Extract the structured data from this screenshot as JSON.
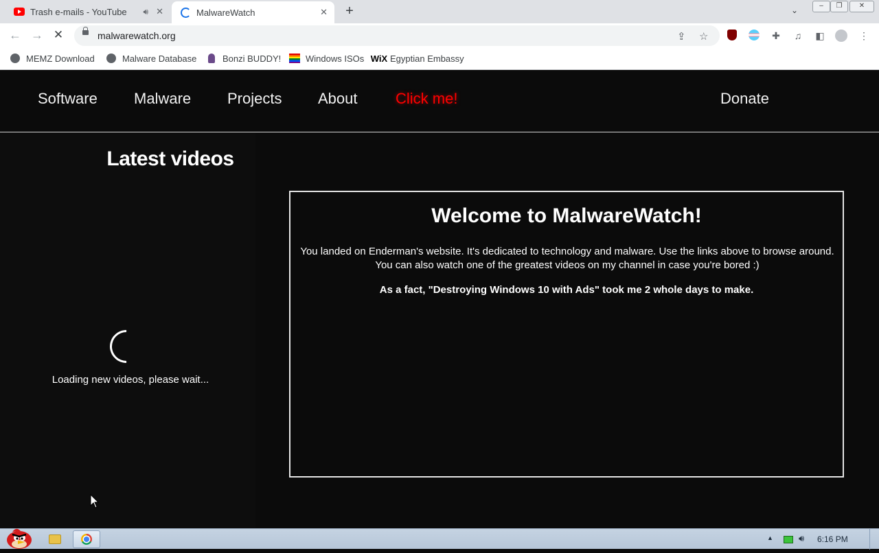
{
  "browser": {
    "tabs": [
      {
        "title": "Trash e-mails - YouTube",
        "active": false,
        "audio": true
      },
      {
        "title": "MalwareWatch",
        "active": true,
        "loading": true
      }
    ],
    "url": "malwarewatch.org",
    "bookmarks": [
      {
        "label": "MEMZ Download",
        "icon": "globe-icon"
      },
      {
        "label": "Malware Database",
        "icon": "globe-icon"
      },
      {
        "label": "Bonzi BUDDY!",
        "icon": "bonzi-icon"
      },
      {
        "label": "Windows ISOs",
        "icon": "rainbow-flag-icon"
      },
      {
        "label": "Egyptian Embassy",
        "icon": "wix-icon",
        "icon_text": "WiX"
      }
    ]
  },
  "site": {
    "nav": {
      "software": "Software",
      "malware": "Malware",
      "projects": "Projects",
      "about": "About",
      "click_me": "Click me!",
      "donate": "Donate"
    },
    "sidebar": {
      "title": "Latest videos",
      "loading_text": "Loading new videos, please wait..."
    },
    "welcome": {
      "title": "Welcome to MalwareWatch!",
      "text": "You landed on Enderman's website. It's dedicated to technology and malware. Use the links above to browse around. You can also watch one of the greatest videos on my channel in case you're bored :)",
      "fact": "As a fact, \"Destroying Windows 10 with Ads\" took me 2 whole days to make."
    },
    "colors": {
      "background": "#0b0b0b",
      "click_me": "#ff0000",
      "text": "#ffffff"
    }
  },
  "taskbar": {
    "clock": "6:16 PM",
    "apps": [
      "explorer-icon",
      "chrome-icon"
    ]
  }
}
